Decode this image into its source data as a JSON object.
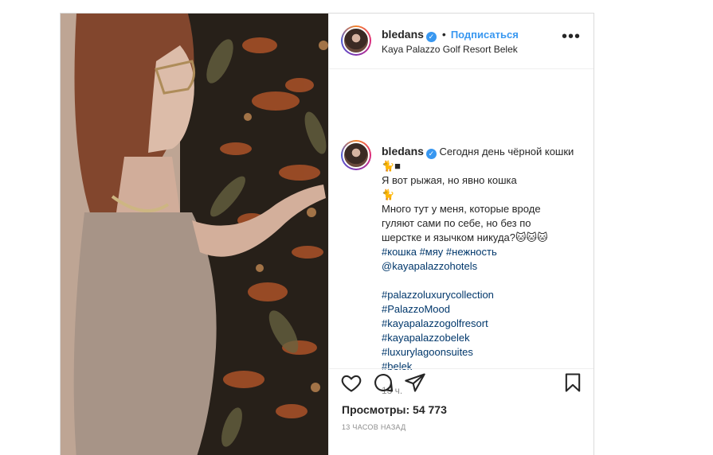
{
  "header": {
    "username": "bledans",
    "verified_mark": "✓",
    "dot": "•",
    "follow_label": "Подписаться",
    "location": "Kaya Palazzo Golf Resort Belek",
    "more_label": "•••"
  },
  "caption": {
    "username": "bledans",
    "verified_mark": "✓",
    "text_1": "Сегодня день чёрной кошки",
    "text_1b": "🐈■",
    "text_2": "Я вот рыжая, но явно кошка",
    "text_2b": "🐈",
    "text_3": "Много тут у меня, которые вроде",
    "text_4": "гуляют сами по себе, но без по",
    "text_5": "шерстке и язычком никуда?🐱🐱🐱",
    "hashtags_line": [
      "#кошка",
      "#мяу",
      "#нежность"
    ],
    "mention": "@kayapalazzohotels",
    "tags": [
      "#palazzoluxurycollection",
      "#PalazzoMood",
      "#kayapalazzogolfresort",
      "#kayapalazzobelek",
      "#luxurylagoonsuites",
      "#belek"
    ],
    "age": "13 ч."
  },
  "actions": {
    "like_icon": "heart-icon",
    "comment_icon": "comment-icon",
    "share_icon": "paper-plane-icon",
    "save_icon": "bookmark-icon"
  },
  "stats": {
    "views": "Просмотры: 54 773",
    "timestamp": "13 ЧАСОВ НАЗАД"
  },
  "colors": {
    "link": "#00376b",
    "follow": "#3897f0",
    "border": "#dbdbdb",
    "muted": "#8e8e8e"
  }
}
